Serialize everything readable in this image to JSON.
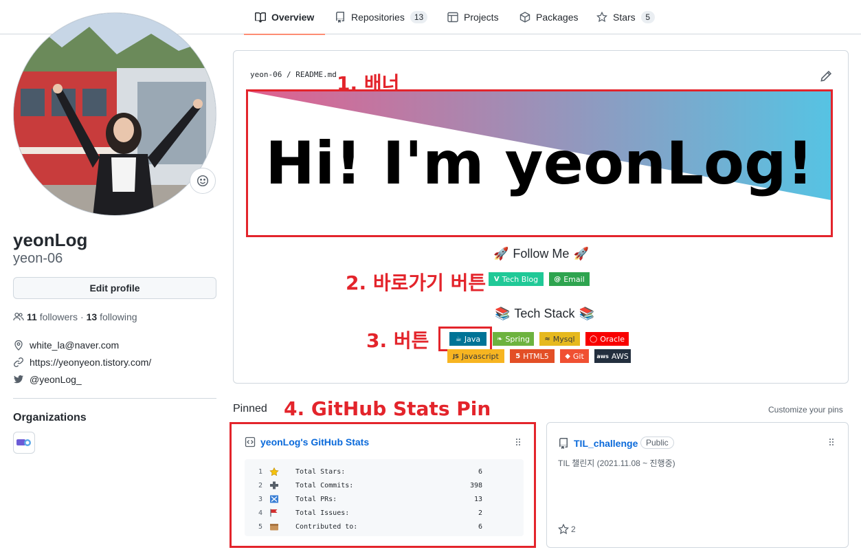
{
  "nav": {
    "tabs": [
      {
        "label": "Overview",
        "count": null,
        "icon": "book-icon"
      },
      {
        "label": "Repositories",
        "count": "13",
        "icon": "repo-icon"
      },
      {
        "label": "Projects",
        "count": null,
        "icon": "table-icon"
      },
      {
        "label": "Packages",
        "count": null,
        "icon": "package-icon"
      },
      {
        "label": "Stars",
        "count": "5",
        "icon": "star-icon"
      }
    ]
  },
  "profile": {
    "name": "yeonLog",
    "login": "yeon-06",
    "edit_label": "Edit profile",
    "followers_count": "11",
    "followers_label": "followers",
    "following_count": "13",
    "following_label": "following",
    "email": "white_la@naver.com",
    "website": "https://yeonyeon.tistory.com/",
    "twitter": "@yeonLog_",
    "organizations_title": "Organizations"
  },
  "readme": {
    "path": "yeon-06 / README.md",
    "banner_text": "Hi! I'm yeonLog!",
    "follow_title": "Follow Me",
    "follow_badges": [
      {
        "label": "Tech Blog",
        "icon_char": "V",
        "color": "#20c997"
      },
      {
        "label": "Email",
        "icon_char": "@",
        "color": "#2ea44f"
      }
    ],
    "tech_title": "Tech Stack",
    "tech_badges_row1": [
      {
        "label": "Java",
        "icon_char": "☕",
        "color": "#007396"
      },
      {
        "label": "Spring",
        "icon_char": "❧",
        "color": "#6db33f"
      },
      {
        "label": "Mysql",
        "icon_char": "≈",
        "color": "#e6b91e"
      },
      {
        "label": "Oracle",
        "icon_char": "◯",
        "color": "#f80000"
      }
    ],
    "tech_badges_row2": [
      {
        "label": "Javascript",
        "icon_char": "JS",
        "color": "#f7df1e"
      },
      {
        "label": "HTML5",
        "icon_char": "5",
        "color": "#e34f26"
      },
      {
        "label": "Git",
        "icon_char": "◆",
        "color": "#f05032"
      },
      {
        "label": "AWS",
        "icon_char": "aws",
        "color": "#232f3e"
      }
    ]
  },
  "annotations": {
    "banner": "1. 배너",
    "shortcut": "2. 바로가기 버튼",
    "button": "3. 버튼",
    "stats_pin": "4. GitHub Stats Pin"
  },
  "pinned": {
    "label": "Pinned",
    "customize": "Customize your pins",
    "stats_card": {
      "title": "yeonLog's GitHub Stats",
      "rows": [
        {
          "n": "1",
          "emoji": "star",
          "label": "Total Stars:",
          "value": "6"
        },
        {
          "n": "2",
          "emoji": "plus",
          "label": "Total Commits:",
          "value": "398"
        },
        {
          "n": "3",
          "emoji": "cross",
          "label": "Total PRs:",
          "value": "13"
        },
        {
          "n": "4",
          "emoji": "flag",
          "label": "Total Issues:",
          "value": "2"
        },
        {
          "n": "5",
          "emoji": "box",
          "label": "Contributed to:",
          "value": "6"
        }
      ]
    },
    "repo_card": {
      "name": "TIL_challenge",
      "visibility": "Public",
      "description": "TIL 챌린지 (2021.11.08 ~ 진행중)",
      "stars": "2"
    }
  },
  "colors": {
    "accent_underline": "#fd8c73",
    "link": "#0969da",
    "annotation_red": "#e3242b",
    "banner_gradient_start": "#d96b92",
    "banner_gradient_end": "#5ec2e0"
  }
}
